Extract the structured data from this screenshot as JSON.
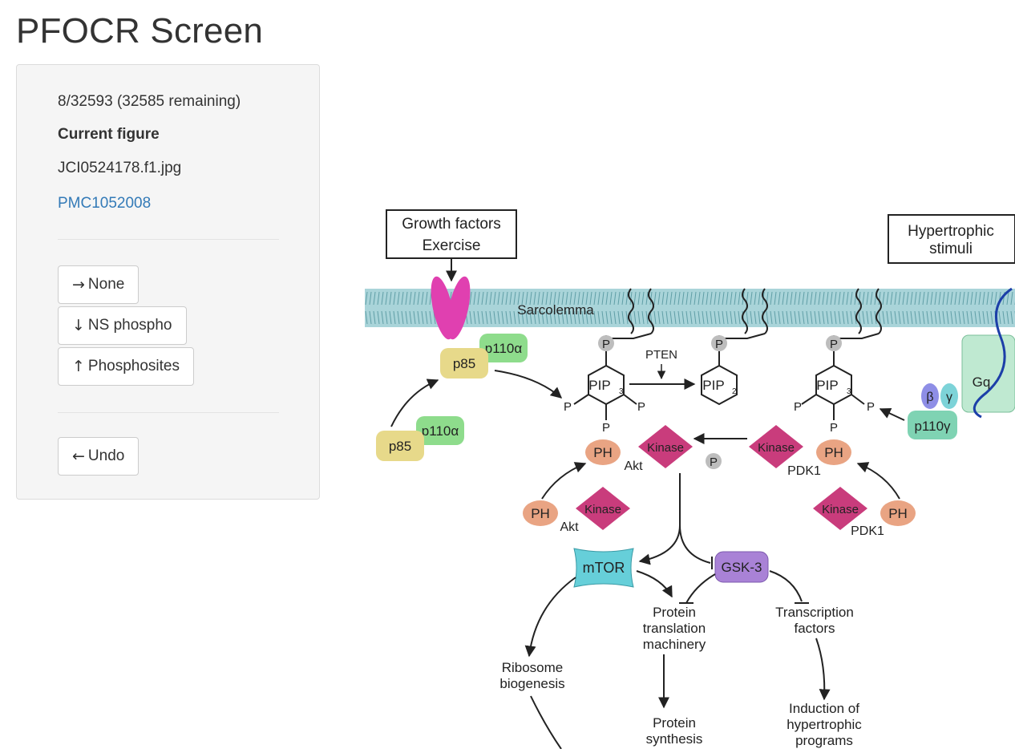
{
  "page": {
    "title": "PFOCR Screen"
  },
  "sidebar": {
    "progress": "8/32593 (32585 remaining)",
    "current_figure_label": "Current figure",
    "figure_filename": "JCI0524178.f1.jpg",
    "pmc_link": "PMC1052008",
    "buttons": {
      "none": {
        "arrow": "→",
        "label": "None"
      },
      "ns_phospho": {
        "arrow": "↓",
        "label": "NS phospho"
      },
      "phosphosites": {
        "arrow": "↑",
        "label": "Phosphosites"
      },
      "undo": {
        "arrow": "←",
        "label": "Undo"
      }
    }
  },
  "figure": {
    "growth_factors": "Growth factors",
    "exercise": "Exercise",
    "hypertrophic": "Hypertrophic",
    "stimuli": "stimuli",
    "sarcolemma": "Sarcolemma",
    "pten": "PTEN",
    "p": "P",
    "pip3": "PIP",
    "pip3_sub": "3",
    "pip2": "PIP",
    "pip2_sub": "2",
    "p85": "p85",
    "p110a": "p110α",
    "p110g": "p110γ",
    "beta": "β",
    "gamma": "γ",
    "gq": "Gq",
    "ph": "PH",
    "kinase": "Kinase",
    "akt": "Akt",
    "pdk1": "PDK1",
    "mtor": "mTOR",
    "gsk3": "GSK-3",
    "protein_translation_1": "Protein",
    "protein_translation_2": "translation",
    "protein_translation_3": "machinery",
    "transcription_1": "Transcription",
    "transcription_2": "factors",
    "ribosome_1": "Ribosome",
    "ribosome_2": "biogenesis",
    "protein_synthesis_1": "Protein",
    "protein_synthesis_2": "synthesis",
    "induction_1": "Induction of",
    "induction_2": "hypertrophic",
    "induction_3": "programs"
  },
  "colors": {
    "link": "#337ab7",
    "membrane": "#a9d4d9",
    "receptor": "#e040b0",
    "kinase": "#c93c7c",
    "ph": "#e9a483",
    "p85": "#e7d98a",
    "p110": "#8edc8c",
    "mtor": "#66cfd9",
    "gsk3": "#a982d6"
  }
}
